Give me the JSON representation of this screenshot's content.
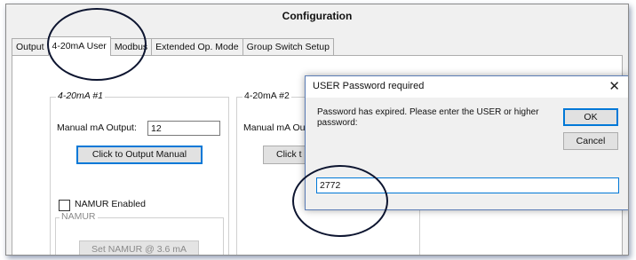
{
  "window": {
    "title": "Configuration"
  },
  "tabs": [
    {
      "label": "Output"
    },
    {
      "label": "4-20mA User"
    },
    {
      "label": "Modbus"
    },
    {
      "label": "Extended Op. Mode"
    },
    {
      "label": "Group Switch Setup"
    }
  ],
  "group1": {
    "title": "4-20mA #1",
    "manual_label": "Manual mA Output:",
    "manual_value": "12",
    "output_button": "Click to Output Manual"
  },
  "group2": {
    "title": "4-20mA #2",
    "manual_label": "Manual mA Ou",
    "output_button": "Click t"
  },
  "namur": {
    "checkbox_label": "NAMUR Enabled",
    "group_title": "NAMUR",
    "button": "Set NAMUR @ 3.6 mA"
  },
  "dialog": {
    "title": "USER Password required",
    "close_glyph": "✕",
    "message": "Password has expired.  Please enter the USER or higher password:",
    "ok_label": "OK",
    "cancel_label": "Cancel",
    "password_value": "2772"
  },
  "colors": {
    "accent": "#0078d7",
    "annotation": "#0d1530"
  }
}
